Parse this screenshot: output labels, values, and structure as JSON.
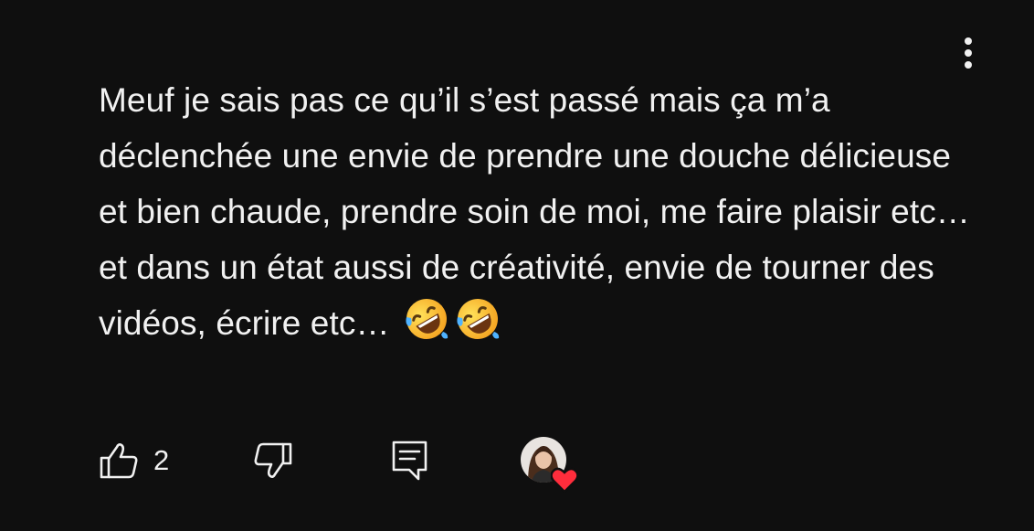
{
  "comment": {
    "text": "Meuf je sais pas ce qu’il s’est passé mais ça m’a déclenchée une envie de prendre une douche délicieuse et bien chaude, prendre soin de moi, me faire plaisir etc… et dans un état aussi de créativité, envie de tourner des vidéos, écrire etc…",
    "emojis": [
      "rolling-on-floor-laughing-emoji",
      "rolling-on-floor-laughing-emoji"
    ]
  },
  "actions": {
    "like_count": "2",
    "like_icon": "thumbs-up-icon",
    "dislike_icon": "thumbs-down-icon",
    "reply_icon": "reply-icon"
  },
  "menu": {
    "icon": "more-vertical-icon"
  },
  "creator": {
    "heart_color": "#ff2d3c"
  }
}
